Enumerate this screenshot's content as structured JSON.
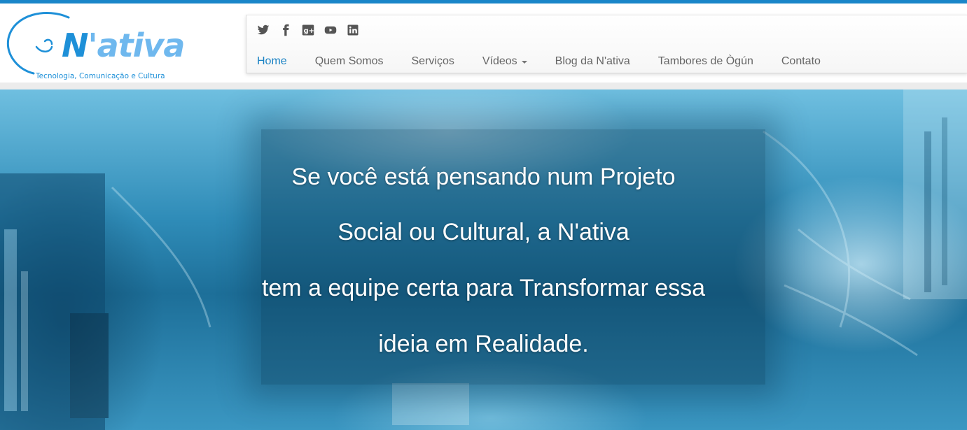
{
  "logo": {
    "name_initial": "N",
    "name_rest": "'ativa",
    "tagline": "Tecnologia, Comunicação e Cultura"
  },
  "social": [
    "twitter-icon",
    "facebook-icon",
    "google-plus-icon",
    "youtube-icon",
    "linkedin-icon"
  ],
  "nav": {
    "items": [
      {
        "label": "Home",
        "active": true
      },
      {
        "label": "Quem Somos"
      },
      {
        "label": "Serviços"
      },
      {
        "label": "Vídeos",
        "dropdown": true
      },
      {
        "label": "Blog da N'ativa"
      },
      {
        "label": "Tambores de Ògún"
      },
      {
        "label": "Contato"
      }
    ]
  },
  "hero": {
    "lines": [
      "Se você está pensando num Projeto",
      "Social ou Cultural, a N'ativa",
      "tem a equipe certa para Transformar essa",
      "ideia em Realidade."
    ]
  },
  "colors": {
    "accent": "#1a86c9",
    "logo_blue": "#1e90d8",
    "nav_text": "#666666",
    "hero_text": "#ffffff"
  }
}
